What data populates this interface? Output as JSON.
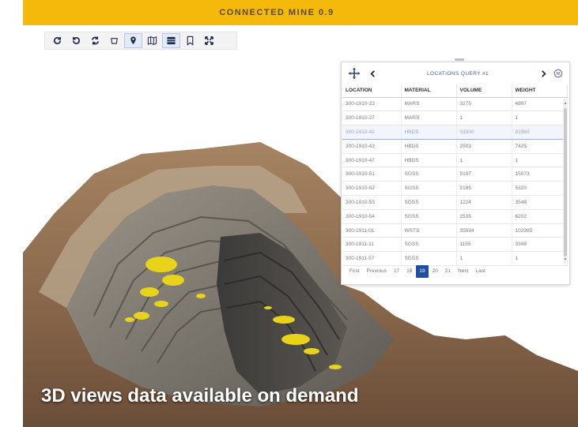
{
  "app": {
    "title": "CONNECTED MINE 0.9"
  },
  "toolbar": {
    "buttons": [
      {
        "name": "refresh-icon",
        "active": false
      },
      {
        "name": "undo-icon",
        "active": false
      },
      {
        "name": "sync-icon",
        "active": false
      },
      {
        "name": "shape-icon",
        "active": false
      },
      {
        "name": "map-pin-icon",
        "active": true
      },
      {
        "name": "map-icon",
        "active": false
      },
      {
        "name": "table-icon",
        "active": true
      },
      {
        "name": "bookmark-icon",
        "active": false
      },
      {
        "name": "fullscreen-icon",
        "active": false
      }
    ]
  },
  "query_panel": {
    "title": "LOCATIONS QUERY #1",
    "columns": [
      "LOCATION",
      "MATERIAL",
      "VOLUME",
      "WEIGHT"
    ],
    "rows": [
      [
        "300-1910-23",
        "MARS",
        "3275",
        "4897"
      ],
      [
        "300-1910-27",
        "MARS",
        "1",
        "1"
      ],
      [
        "300-1910-42",
        "HBDS",
        "33300",
        "83360"
      ],
      [
        "300-1910-43",
        "HBDS",
        "2503",
        "7425"
      ],
      [
        "300-1910-47",
        "HBDS",
        "1",
        "1"
      ],
      [
        "300-1910-51",
        "SGSS",
        "5197",
        "15073"
      ],
      [
        "300-1910-52",
        "SGSS",
        "2185",
        "5320"
      ],
      [
        "300-1910-53",
        "SGSS",
        "1224",
        "3548"
      ],
      [
        "300-1910-54",
        "SGSS",
        "2535",
        "6202"
      ],
      [
        "300-1911-01",
        "WSTS",
        "35594",
        "102985"
      ],
      [
        "300-1911-11",
        "SGSS",
        "1155",
        "3349"
      ],
      [
        "300-1911-57",
        "SGSS",
        "1",
        "1"
      ]
    ],
    "selected_row": 2,
    "pager": [
      "First",
      "Previous",
      "17",
      "18",
      "19",
      "20",
      "21",
      "Next",
      "Last"
    ],
    "current_page": "19"
  },
  "caption": "3D views data available on demand",
  "colors": {
    "title_bar": "#f5b90c",
    "accent": "#1f4fa0",
    "ore_highlight": "#e8d21a"
  }
}
